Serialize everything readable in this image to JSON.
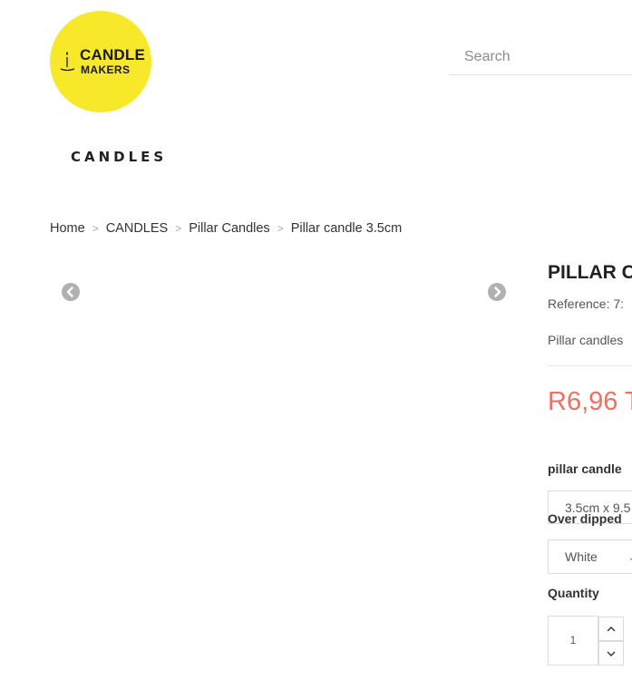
{
  "brand": {
    "logo_line1": "CANDLE",
    "logo_line2": "MAKERS",
    "accent": "#f7e82a"
  },
  "search": {
    "placeholder": "Search"
  },
  "nav": {
    "category": "CANDLES"
  },
  "breadcrumb": [
    {
      "label": "Home"
    },
    {
      "label": "CANDLES"
    },
    {
      "label": "Pillar Candles"
    },
    {
      "label": "Pillar candle 3.5cm"
    }
  ],
  "breadcrumb_separator": ">",
  "product": {
    "title": "PILLAR C",
    "reference": "Reference: 7:",
    "description": "Pillar candles",
    "price": "R6,96 T",
    "price_color": "#f06f5d",
    "size_label": "pillar candle",
    "size_value": "3.5cm x 9.5",
    "color_label": "Over dipped",
    "color_value": "White",
    "quantity_label": "Quantity",
    "quantity_value": "1"
  },
  "icons": {
    "carousel_prev": "chevron-left-circle",
    "carousel_next": "chevron-right-circle",
    "qty_up": "chevron-up",
    "qty_down": "chevron-down",
    "select_caret": "chevron-down"
  }
}
